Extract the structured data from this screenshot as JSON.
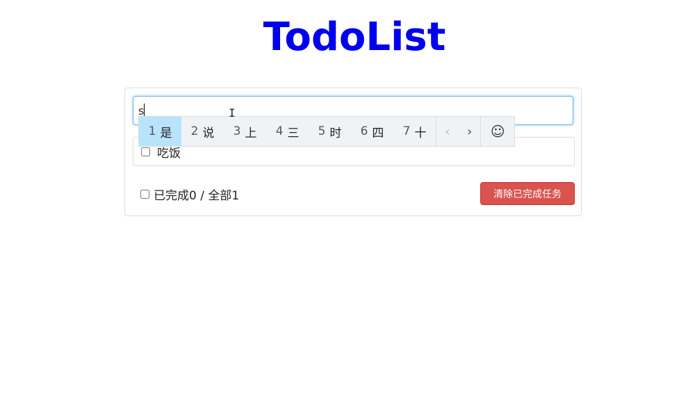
{
  "app": {
    "title": "TodoList"
  },
  "input": {
    "value": "s",
    "placeholder": ""
  },
  "todos": [
    {
      "text": "吃饭",
      "done": false
    }
  ],
  "footer": {
    "status_text": "已完成0 / 全部1",
    "clear_button_label": "清除已完成任务"
  },
  "ime": {
    "candidates": [
      {
        "num": "1",
        "char": "是"
      },
      {
        "num": "2",
        "char": "说"
      },
      {
        "num": "3",
        "char": "上"
      },
      {
        "num": "4",
        "char": "三"
      },
      {
        "num": "5",
        "char": "时"
      },
      {
        "num": "6",
        "char": "四"
      },
      {
        "num": "7",
        "char": "十"
      }
    ],
    "prev_glyph": "‹",
    "next_glyph": "›",
    "emoji_glyph": "☺",
    "selected_index": 0
  },
  "colors": {
    "title": "#0000ee",
    "danger": "#d9534f",
    "ime_highlight": "#b7e4fb",
    "input_focus_border": "#66afe9"
  }
}
